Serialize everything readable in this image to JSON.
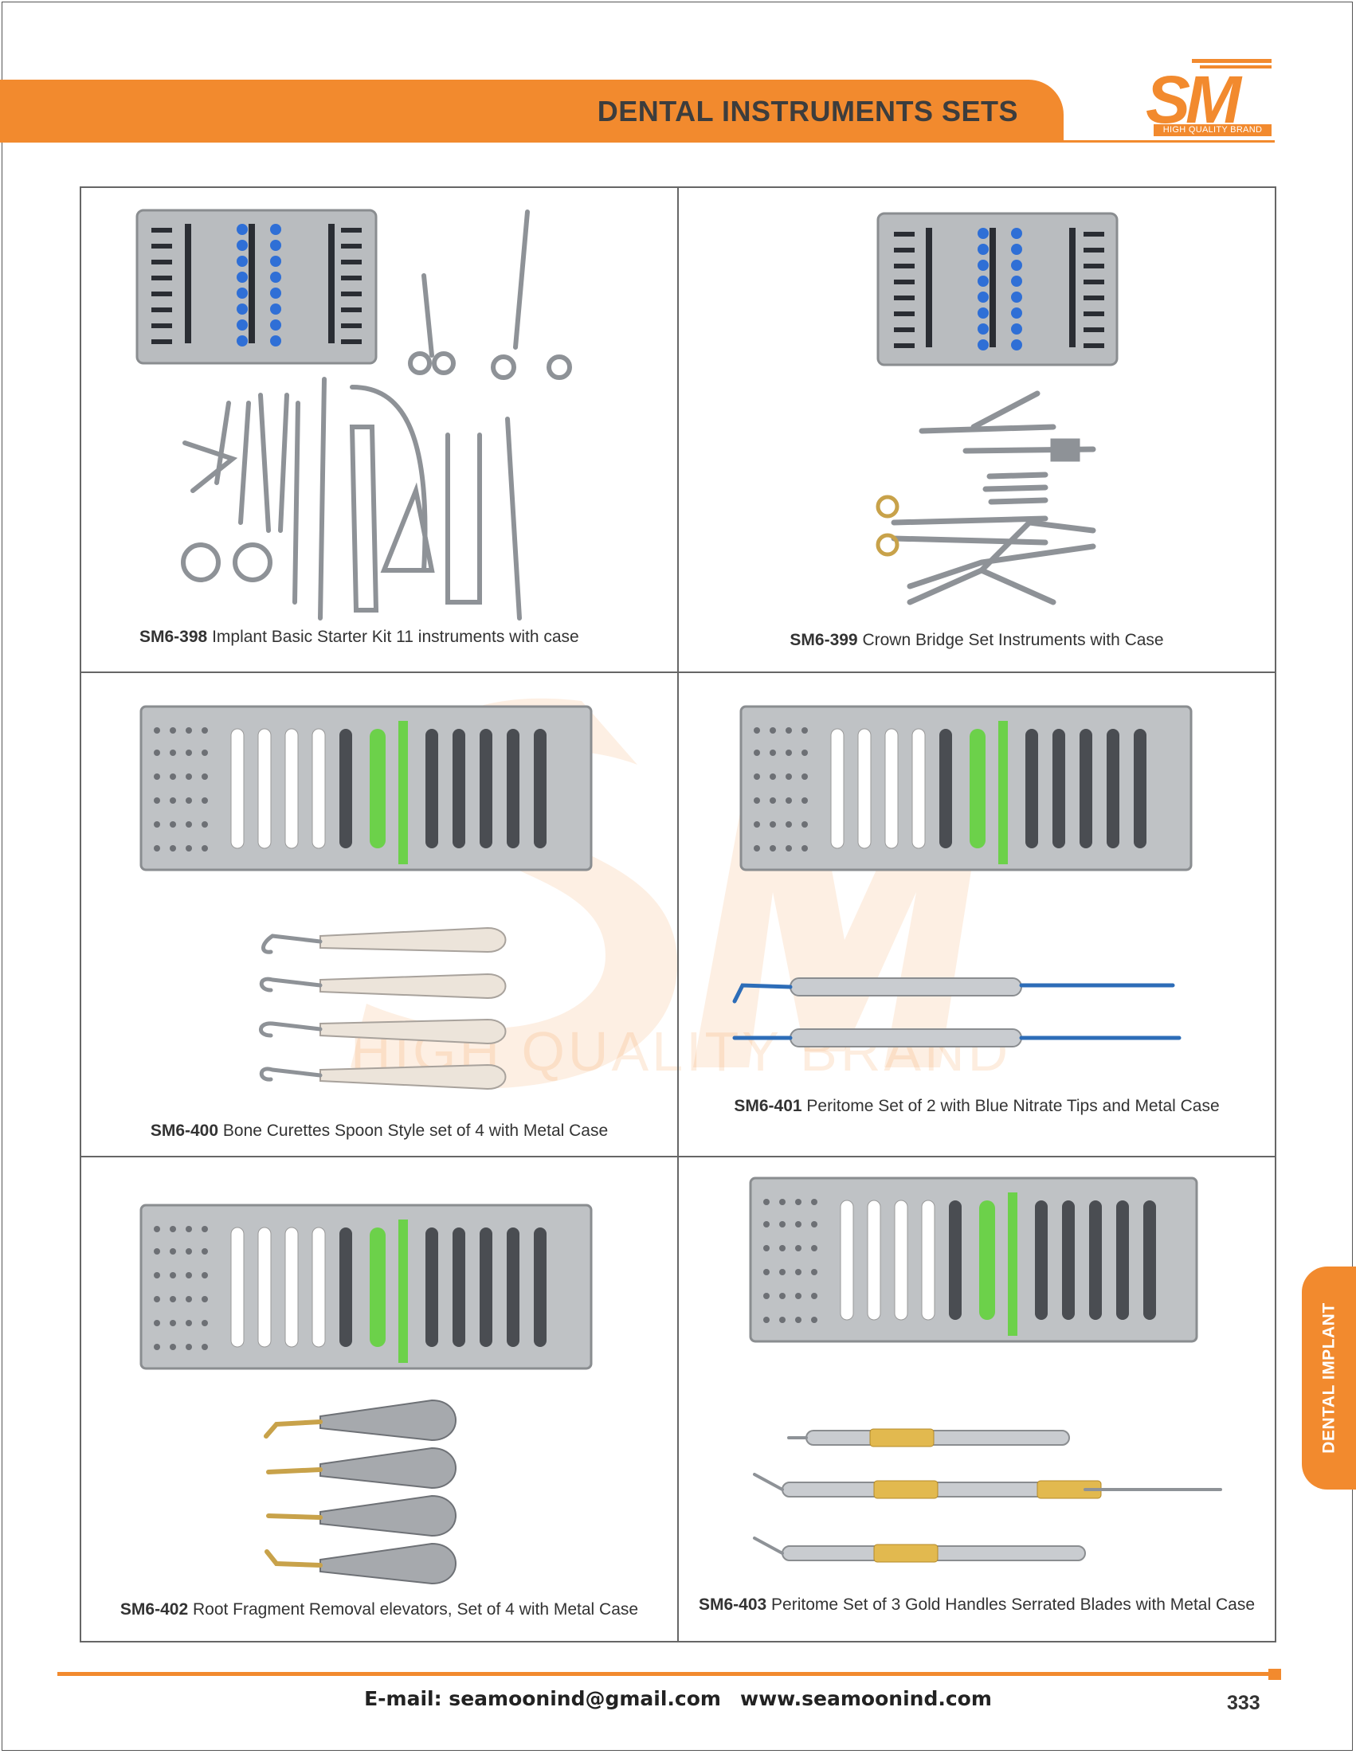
{
  "header": {
    "title": "DENTAL INSTRUMENTS SETS",
    "logo_text": "SM",
    "logo_tagline": "HIGH QUALITY BRAND",
    "brand_color": "#f28a2e"
  },
  "watermark": {
    "text": "HIGH QUALITY BRAND"
  },
  "products": [
    {
      "code": "SM6-398",
      "description": "Implant Basic Starter Kit 11 instruments with case"
    },
    {
      "code": "SM6-399",
      "description": "Crown Bridge Set Instruments with Case"
    },
    {
      "code": "SM6-400",
      "description": "Bone Curettes Spoon Style set of 4 with Metal Case"
    },
    {
      "code": "SM6-401",
      "description": "Peritome Set of 2 with Blue Nitrate Tips and Metal Case"
    },
    {
      "code": "SM6-402",
      "description": "Root Fragment Removal elevators, Set of 4 with Metal Case"
    },
    {
      "code": "SM6-403",
      "description": "Peritome Set of 3 Gold Handles Serrated Blades with Metal Case"
    }
  ],
  "side_tab": {
    "label": "DENTAL IMPLANT"
  },
  "footer": {
    "email": "E-mail: seamoonind@gmail.com",
    "website": "www.seamoonind.com",
    "page_number": "333"
  }
}
